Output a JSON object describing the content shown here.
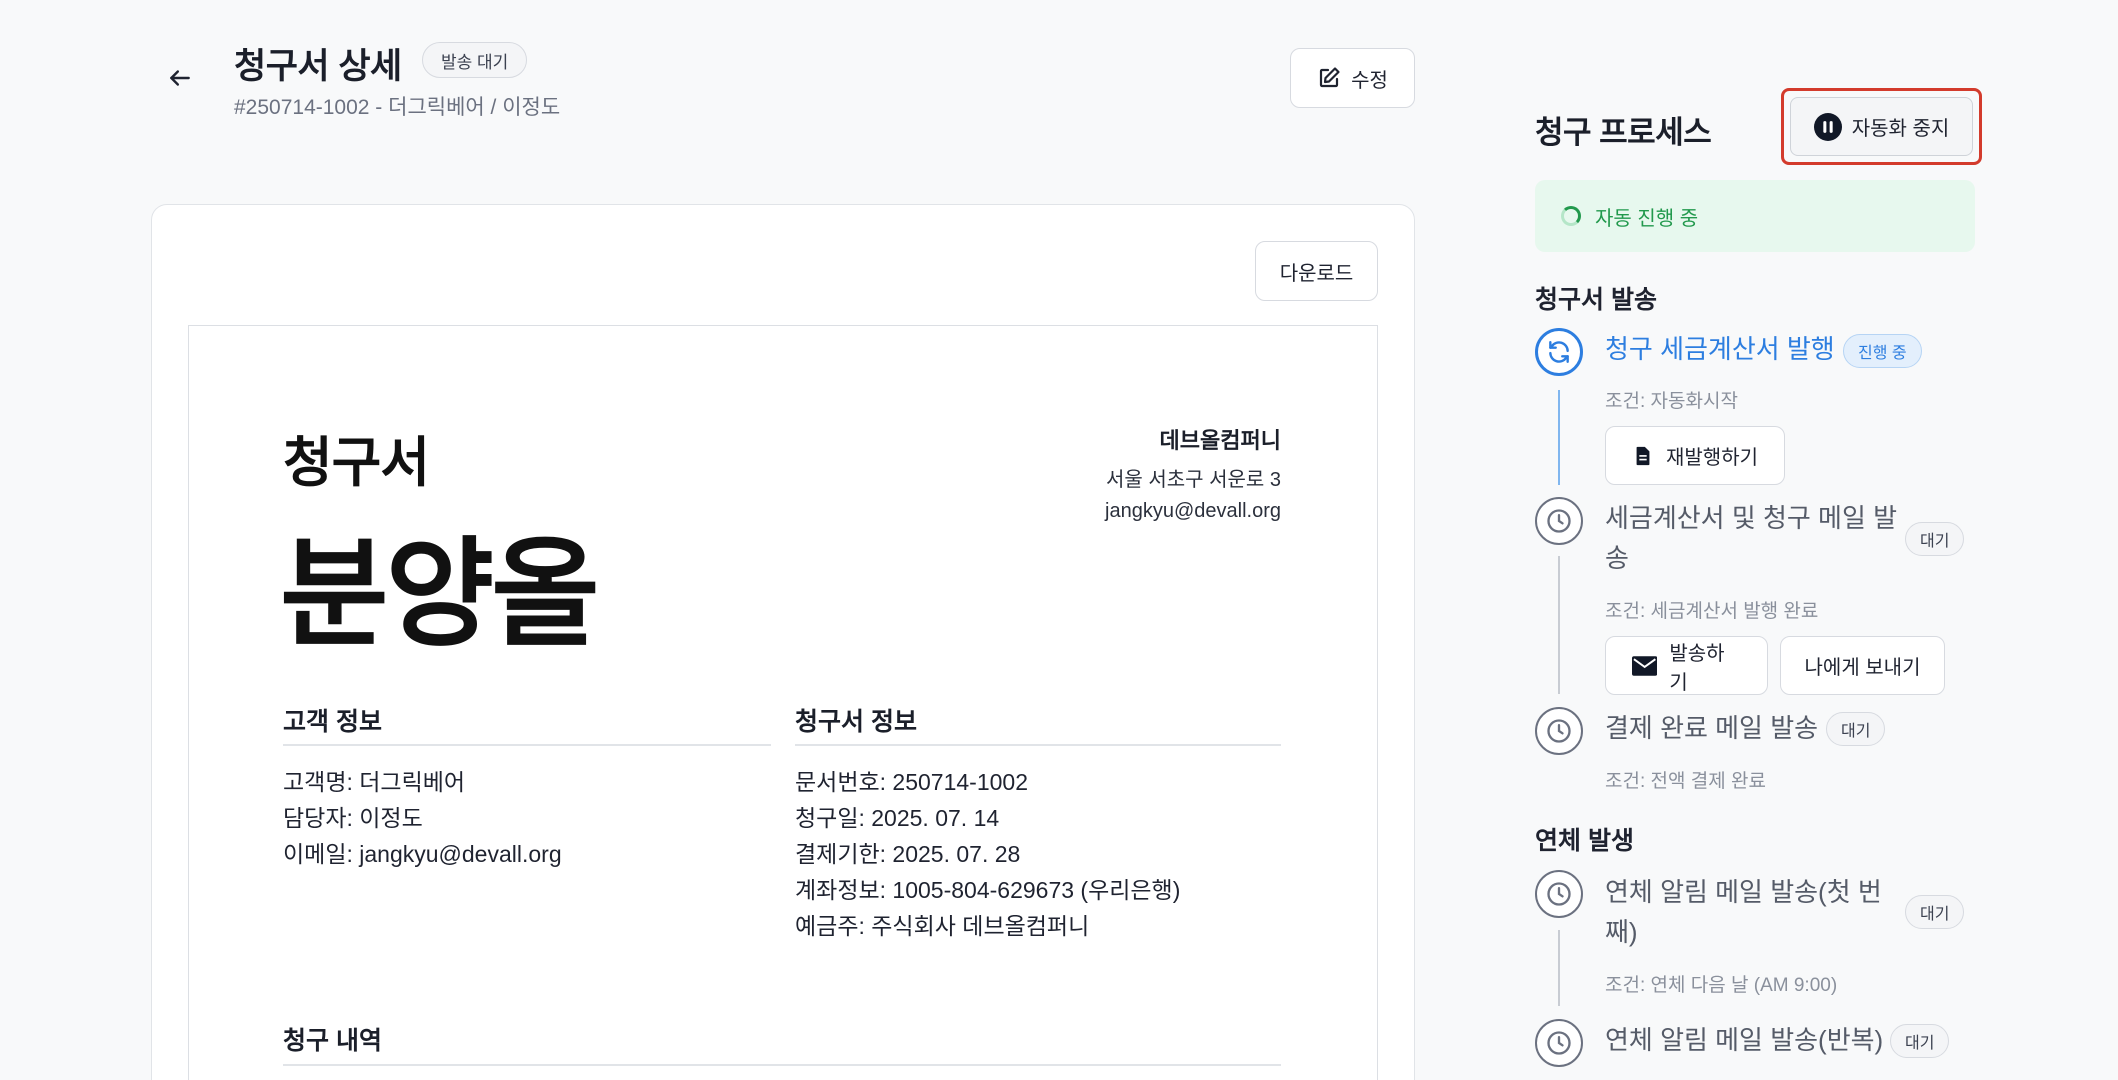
{
  "header": {
    "title": "청구서 상세",
    "status_badge": "발송 대기",
    "subtitle": "#250714-1002 - 더그릭베어 / 이정도",
    "edit_label": "수정"
  },
  "document": {
    "download_label": "다운로드",
    "title": "청구서",
    "big_label": "분양올",
    "company": {
      "name": "데브올컴퍼니",
      "address": "서울 서초구 서운로 3",
      "email": "jangkyu@devall.org"
    },
    "customer_section": {
      "heading": "고객 정보",
      "lines": [
        "고객명: 더그릭베어",
        "담당자: 이정도",
        "이메일: jangkyu@devall.org"
      ]
    },
    "invoice_section": {
      "heading": "청구서 정보",
      "lines": [
        "문서번호: 250714-1002",
        "청구일: 2025. 07. 14",
        "결제기한: 2025. 07. 28",
        "계좌정보: 1005-804-629673 (우리은행)",
        "예금주: 주식회사 데브올컴퍼니"
      ]
    },
    "items_heading": "청구 내역"
  },
  "panel": {
    "title": "청구 프로세스",
    "pause_label": "자동화 중지",
    "auto_status": "자동 진행 중",
    "groups": [
      {
        "heading": "청구서 발송",
        "steps": [
          {
            "title": "청구 세금계산서 발행",
            "status": "진행 중",
            "condition": "조건: 자동화시작",
            "actions": [
              "재발행하기"
            ]
          },
          {
            "title_line1": "세금계산서 및 청구 메일 발",
            "title_line2": "송",
            "status": "대기",
            "condition": "조건: 세금계산서 발행 완료",
            "actions": [
              "발송하기",
              "나에게 보내기"
            ]
          },
          {
            "title": "결제 완료 메일 발송",
            "status": "대기",
            "condition": "조건: 전액 결제 완료"
          }
        ]
      },
      {
        "heading": "연체 발생",
        "steps": [
          {
            "title_line1": "연체 알림 메일 발송(첫 번",
            "title_line2": "째)",
            "status": "대기",
            "condition": "조건: 연체 다음 날 (AM 9:00)"
          },
          {
            "title": "연체 알림 메일 발송(반복)",
            "status": "대기"
          }
        ]
      }
    ]
  },
  "colors": {
    "accent": "#2d7ee0",
    "success": "#22994d",
    "success_bg": "#e7f8ee",
    "focus": "#d33b2c"
  }
}
